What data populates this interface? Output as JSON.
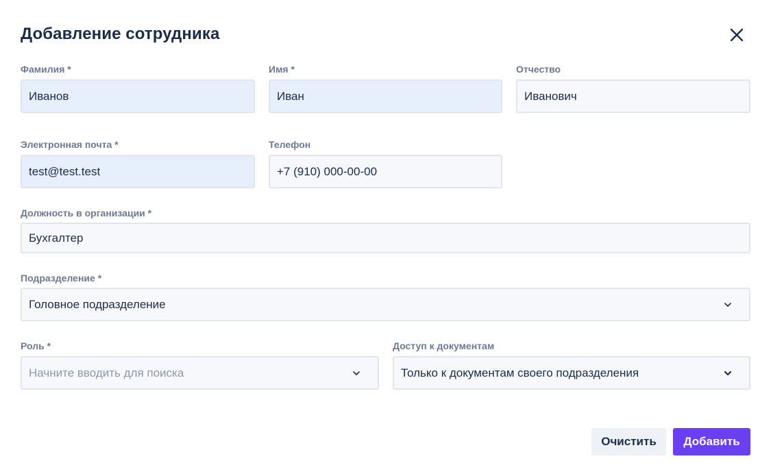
{
  "dialog": {
    "title": "Добавление сотрудника"
  },
  "fields": {
    "last_name": {
      "label": "Фамилия *",
      "value": "Иванов"
    },
    "first_name": {
      "label": "Имя *",
      "value": "Иван"
    },
    "patronymic": {
      "label": "Отчество",
      "value": "Иванович"
    },
    "email": {
      "label": "Электронная почта *",
      "value": "test@test.test"
    },
    "phone": {
      "label": "Телефон",
      "value": "+7 (910) 000-00-00"
    },
    "position": {
      "label": "Должность в организации *",
      "value": "Бухгалтер"
    },
    "department": {
      "label": "Подразделение *",
      "value": "Головное подразделение"
    },
    "role": {
      "label": "Роль *",
      "placeholder": "Начните вводить для поиска"
    },
    "doc_access": {
      "label": "Доступ к документам",
      "value": "Только к документам своего подразделения"
    }
  },
  "actions": {
    "clear_label": "Очистить",
    "add_label": "Добавить"
  },
  "colors": {
    "accent": "#6a3ff0",
    "filled_input_bg": "#e8effc",
    "input_bg": "#f6f8fb",
    "title": "#1b2c4b",
    "label": "#6b7a93"
  },
  "icons": {
    "close": "close-icon",
    "dropdown": "chevron-down-icon"
  }
}
